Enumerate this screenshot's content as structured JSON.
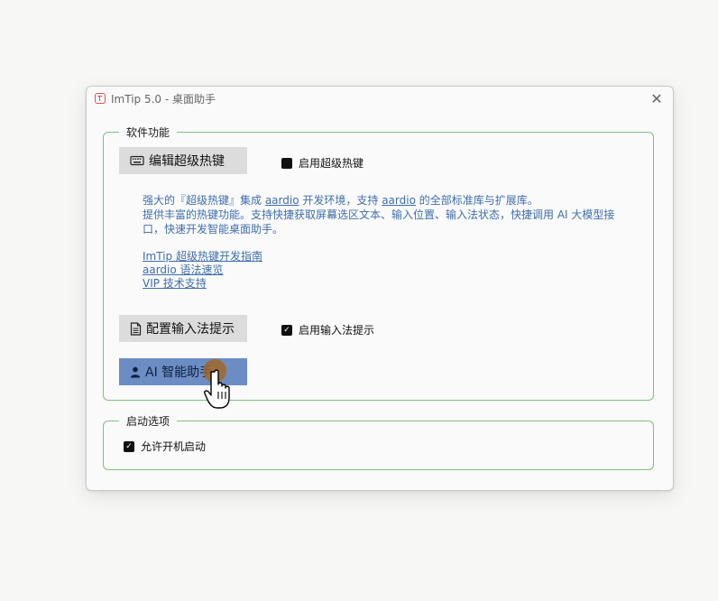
{
  "window": {
    "title": "ImTip 5.0 - 桌面助手"
  },
  "groups": {
    "features": {
      "legend": "软件功能",
      "edit_hotkey_button": "编辑超级热键",
      "enable_hotkey_label": "启用超级热键",
      "enable_hotkey_checked": true,
      "description": {
        "l1_a": "强大的『超级热键』集成 ",
        "l1_b": "aardio",
        "l1_c": " 开发环境，支持 ",
        "l1_d": "aardio",
        "l1_e": " 的全部标准库与扩展库。",
        "l2": "提供丰富的热键功能。支持快捷获取屏幕选区文本、输入位置、输入法状态，快捷调用 AI 大模型接",
        "l3": "口，快速开发智能桌面助手。"
      },
      "links": [
        "ImTip 超级热键开发指南",
        "aardio 语法速览",
        "VIP 技术支持"
      ],
      "config_ime_button": "配置输入法提示",
      "enable_ime_label": "启用输入法提示",
      "enable_ime_checked": true,
      "ai_button": "AI 智能助手"
    },
    "startup": {
      "legend": "启动选项",
      "allow_startup_label": "允许开机启动",
      "allow_startup_checked": true
    }
  },
  "icons": {
    "app": "app-logo-icon",
    "close": "close-icon",
    "keyboard": "keyboard-icon",
    "document": "document-icon",
    "user": "user-icon",
    "pointer": "hand-pointer-icon"
  },
  "colors": {
    "accent_button": "#6b8dc4",
    "link": "#3e6eaa",
    "group_border": "#7fbf7f",
    "app_icon": "#d9534f"
  }
}
